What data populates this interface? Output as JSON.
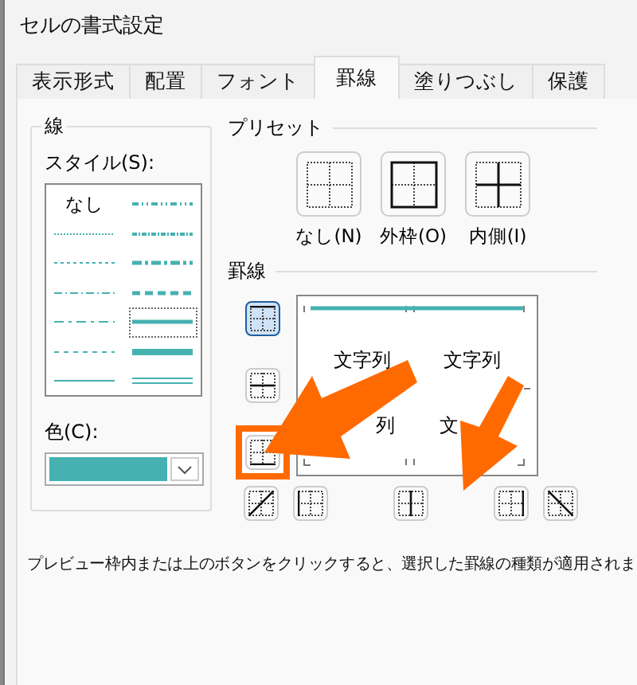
{
  "window": {
    "title": "セルの書式設定"
  },
  "tabs": [
    {
      "label": "表示形式",
      "selected": false
    },
    {
      "label": "配置",
      "selected": false
    },
    {
      "label": "フォント",
      "selected": false
    },
    {
      "label": "罫線",
      "selected": true
    },
    {
      "label": "塗りつぶし",
      "selected": false
    },
    {
      "label": "保護",
      "selected": false
    }
  ],
  "line": {
    "title": "線",
    "style_label": "スタイル(S):",
    "styles": [
      {
        "kind": "none",
        "label": "なし",
        "selected": false
      },
      {
        "kind": "dashdotdot",
        "selected": false
      },
      {
        "kind": "hair",
        "selected": false
      },
      {
        "kind": "slant",
        "selected": false
      },
      {
        "kind": "dotted",
        "selected": false
      },
      {
        "kind": "mediumdashdot",
        "selected": false
      },
      {
        "kind": "dashdot",
        "selected": false
      },
      {
        "kind": "mediumdashed",
        "selected": false
      },
      {
        "kind": "dashdotlong",
        "selected": false
      },
      {
        "kind": "medium",
        "selected": true
      },
      {
        "kind": "dashed",
        "selected": false
      },
      {
        "kind": "thick",
        "selected": false
      },
      {
        "kind": "thin",
        "selected": false
      },
      {
        "kind": "double",
        "selected": false
      }
    ],
    "color_label": "色(C):",
    "color": "#46b1b1"
  },
  "presets": {
    "title": "プリセット",
    "items": [
      {
        "kind": "none",
        "label": "なし(N)"
      },
      {
        "kind": "outline",
        "label": "外枠(O)"
      },
      {
        "kind": "inside",
        "label": "内側(I)"
      }
    ]
  },
  "borders": {
    "title": "罫線",
    "side_buttons": [
      {
        "kind": "top",
        "selected": true
      },
      {
        "kind": "middle",
        "selected": false
      },
      {
        "kind": "bottom",
        "selected": false
      }
    ],
    "bottom_buttons": [
      {
        "kind": "diag-up",
        "selected": false
      },
      {
        "kind": "left",
        "selected": false
      },
      {
        "kind": "center",
        "selected": false
      },
      {
        "kind": "right",
        "selected": false
      },
      {
        "kind": "diag-down",
        "selected": false
      }
    ],
    "preview_texts": [
      "文字列",
      "文字列",
      "列",
      "文"
    ]
  },
  "description": "プレビュー枠内または上のボタンをクリックすると、選択した罫線の種類が適用されま"
}
